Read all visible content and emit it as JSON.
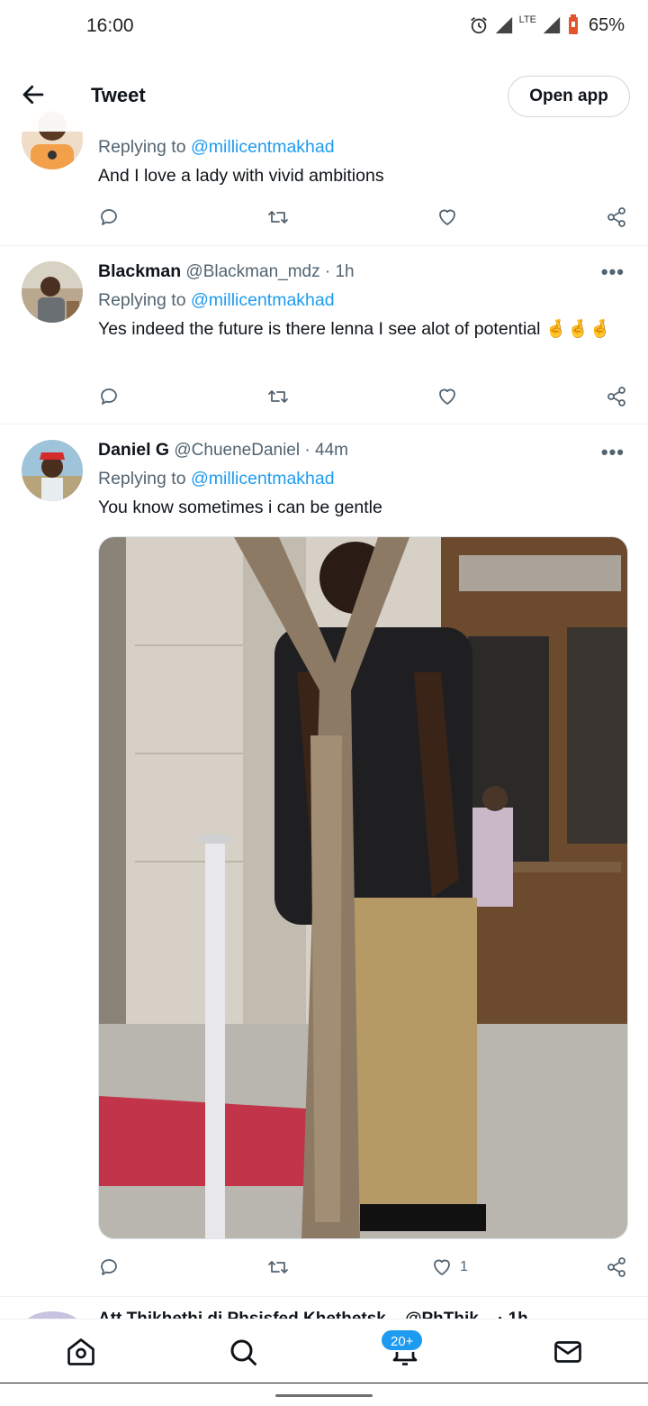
{
  "status_bar": {
    "time": "16:00",
    "network": "LTE",
    "battery": "65%"
  },
  "header": {
    "title": "Tweet",
    "open_app_label": "Open app"
  },
  "tweets": [
    {
      "reply_prefix": "Replying to",
      "reply_handle": "@millicentmakhad",
      "text": "And I love a lady with vivid ambitions"
    },
    {
      "name": "Blackman",
      "handle": "@Blackman_mdz",
      "time": "· 1h",
      "reply_prefix": "Replying to",
      "reply_handle": "@millicentmakhad",
      "text": "Yes indeed the future is there lenna I see alot of potential 🤞🤞🤞"
    },
    {
      "name": "Daniel G",
      "handle": "@ChueneDaniel",
      "time": "· 44m",
      "reply_prefix": "Replying to",
      "reply_handle": "@millicentmakhad",
      "text": "You know sometimes i can be gentle",
      "like_count": "1"
    }
  ],
  "partial_tweet": {
    "text": "Att Thikhethi di Phsisfed Khethetsk... @PhThik... · 1h"
  },
  "bottom_nav": {
    "notifications_badge": "20+"
  },
  "icons": [
    "alarm-icon",
    "signal-icon",
    "battery-icon",
    "back-arrow-icon",
    "reply-icon",
    "retweet-icon",
    "like-icon",
    "share-icon",
    "more-icon",
    "home-icon",
    "search-icon",
    "notifications-icon",
    "messages-icon"
  ],
  "colors": {
    "accent": "#1d9bf0",
    "text_primary": "#0f1419",
    "text_secondary": "#536471",
    "border": "#eff3f4"
  }
}
